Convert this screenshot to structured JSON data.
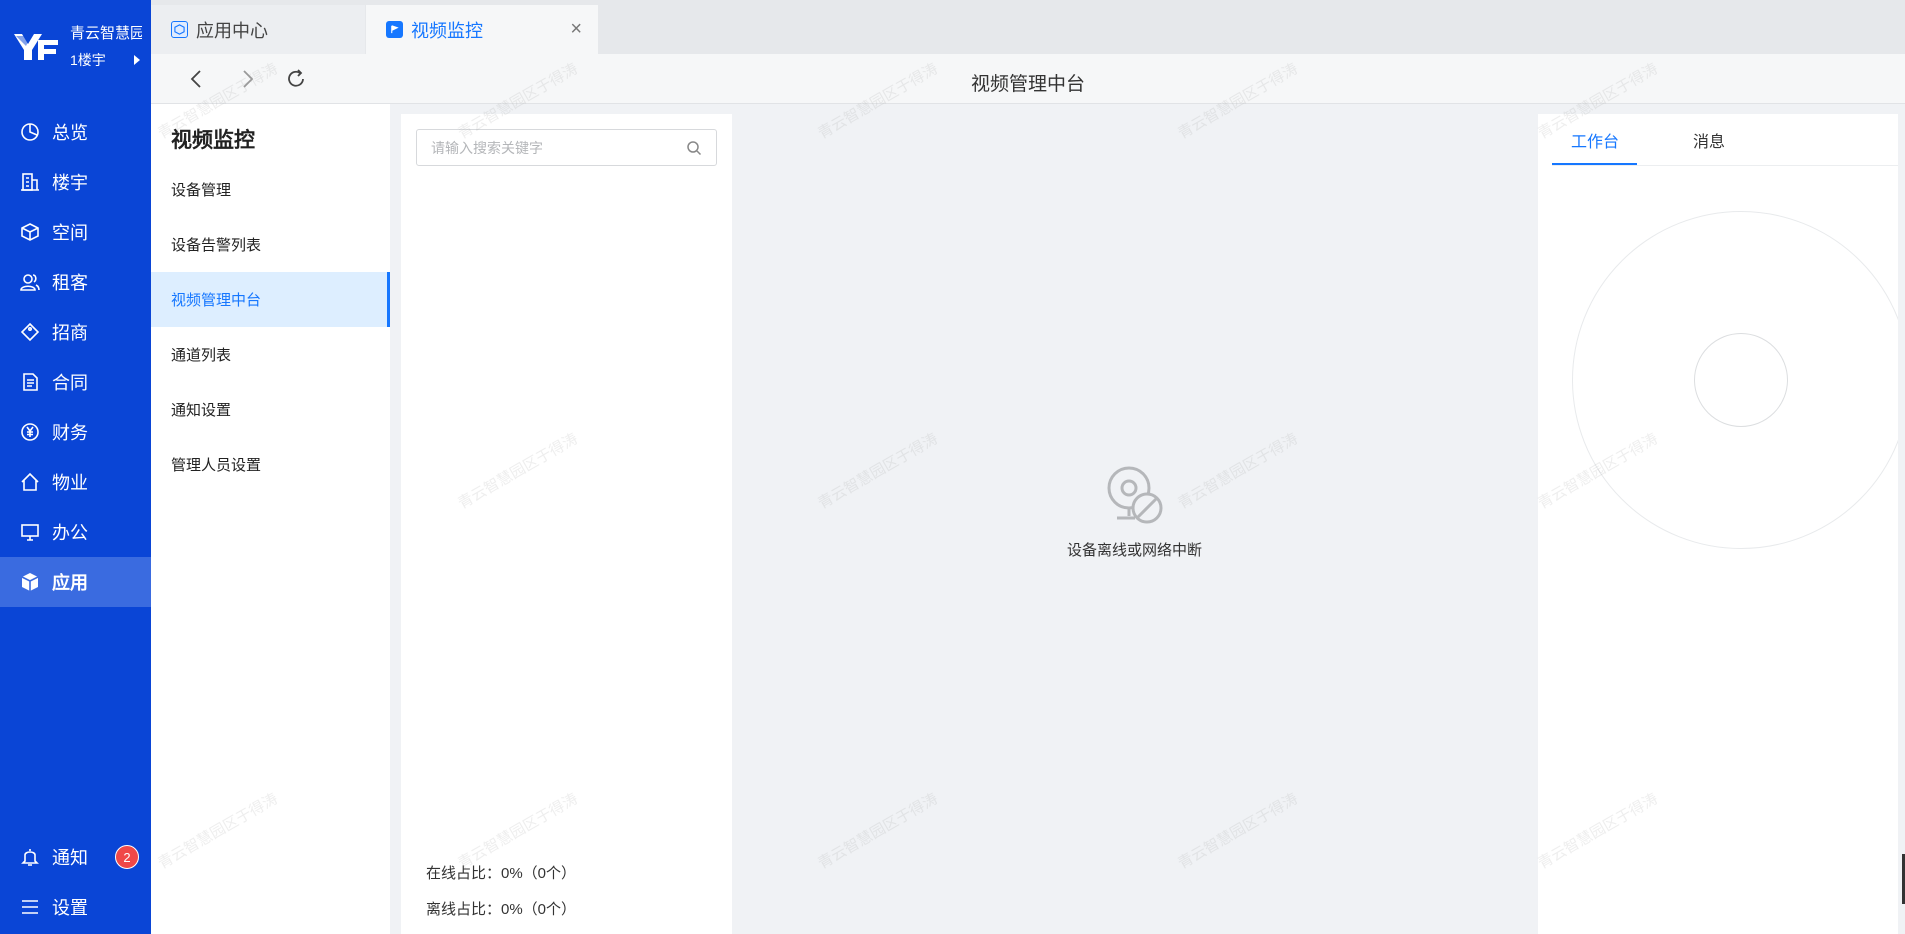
{
  "brand": {
    "org": "青云智慧园区",
    "building": "1楼宇"
  },
  "nav": {
    "items": [
      {
        "label": "总览",
        "icon": "pie-chart-icon"
      },
      {
        "label": "楼宇",
        "icon": "building-icon"
      },
      {
        "label": "空间",
        "icon": "cube-icon"
      },
      {
        "label": "租客",
        "icon": "users-icon"
      },
      {
        "label": "招商",
        "icon": "tag-icon"
      },
      {
        "label": "合同",
        "icon": "document-icon"
      },
      {
        "label": "财务",
        "icon": "yen-icon"
      },
      {
        "label": "物业",
        "icon": "home-icon"
      },
      {
        "label": "办公",
        "icon": "monitor-icon"
      },
      {
        "label": "应用",
        "icon": "box-icon",
        "active": true
      }
    ],
    "notify": {
      "label": "通知",
      "count": "2"
    },
    "settings": {
      "label": "设置"
    }
  },
  "tabs": [
    {
      "label": "应用中心"
    },
    {
      "label": "视频监控",
      "active": true
    }
  ],
  "toolbar": {
    "title": "视频管理中台"
  },
  "submenu": {
    "title": "视频监控",
    "items": [
      "设备管理",
      "设备告警列表",
      "视频管理中台",
      "通道列表",
      "通知设置",
      "管理人员设置"
    ],
    "active_index": 2
  },
  "tree": {
    "search_placeholder": "请输入搜索关键字",
    "online": "在线占比：0%（0个）",
    "offline": "离线占比：0%（0个）"
  },
  "video": {
    "message": "设备离线或网络中断"
  },
  "right_panel": {
    "tabs": [
      "工作台",
      "消息"
    ]
  },
  "watermark": "青云智慧园区于得涛",
  "colors": {
    "nav_bg": "#0a45d6",
    "accent": "#1677ff",
    "badge": "#f04848"
  }
}
